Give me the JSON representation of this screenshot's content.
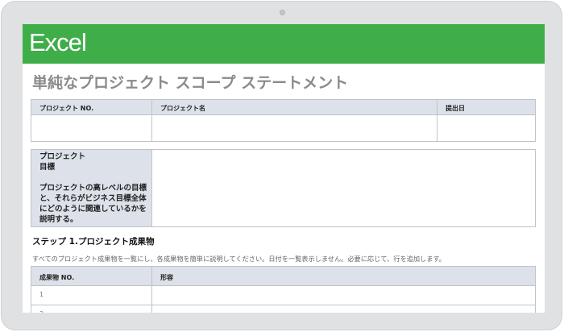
{
  "banner": {
    "app_name": "Excel"
  },
  "document": {
    "title": "単純なプロジェクト スコープ ステートメント"
  },
  "project_table": {
    "headers": [
      "プロジェクト NO.",
      "プロジェクト名",
      "提出日"
    ]
  },
  "objective": {
    "label": "プロジェクト\n目標",
    "description": "プロジェクトの高レベルの目標と、それらがビジネス目標全体にどのように関連しているかを説明する。"
  },
  "step1": {
    "title": "ステップ 1.プロジェクト成果物",
    "instruction": "すべてのプロジェクト成果物を一覧にし、各成果物を簡単に説明してください。日付を一覧表示しません。必要に応じて、行を追加します。",
    "headers": [
      "成果物 NO.",
      "形容"
    ],
    "rows": [
      {
        "no": "1"
      },
      {
        "no": "2"
      }
    ]
  }
}
